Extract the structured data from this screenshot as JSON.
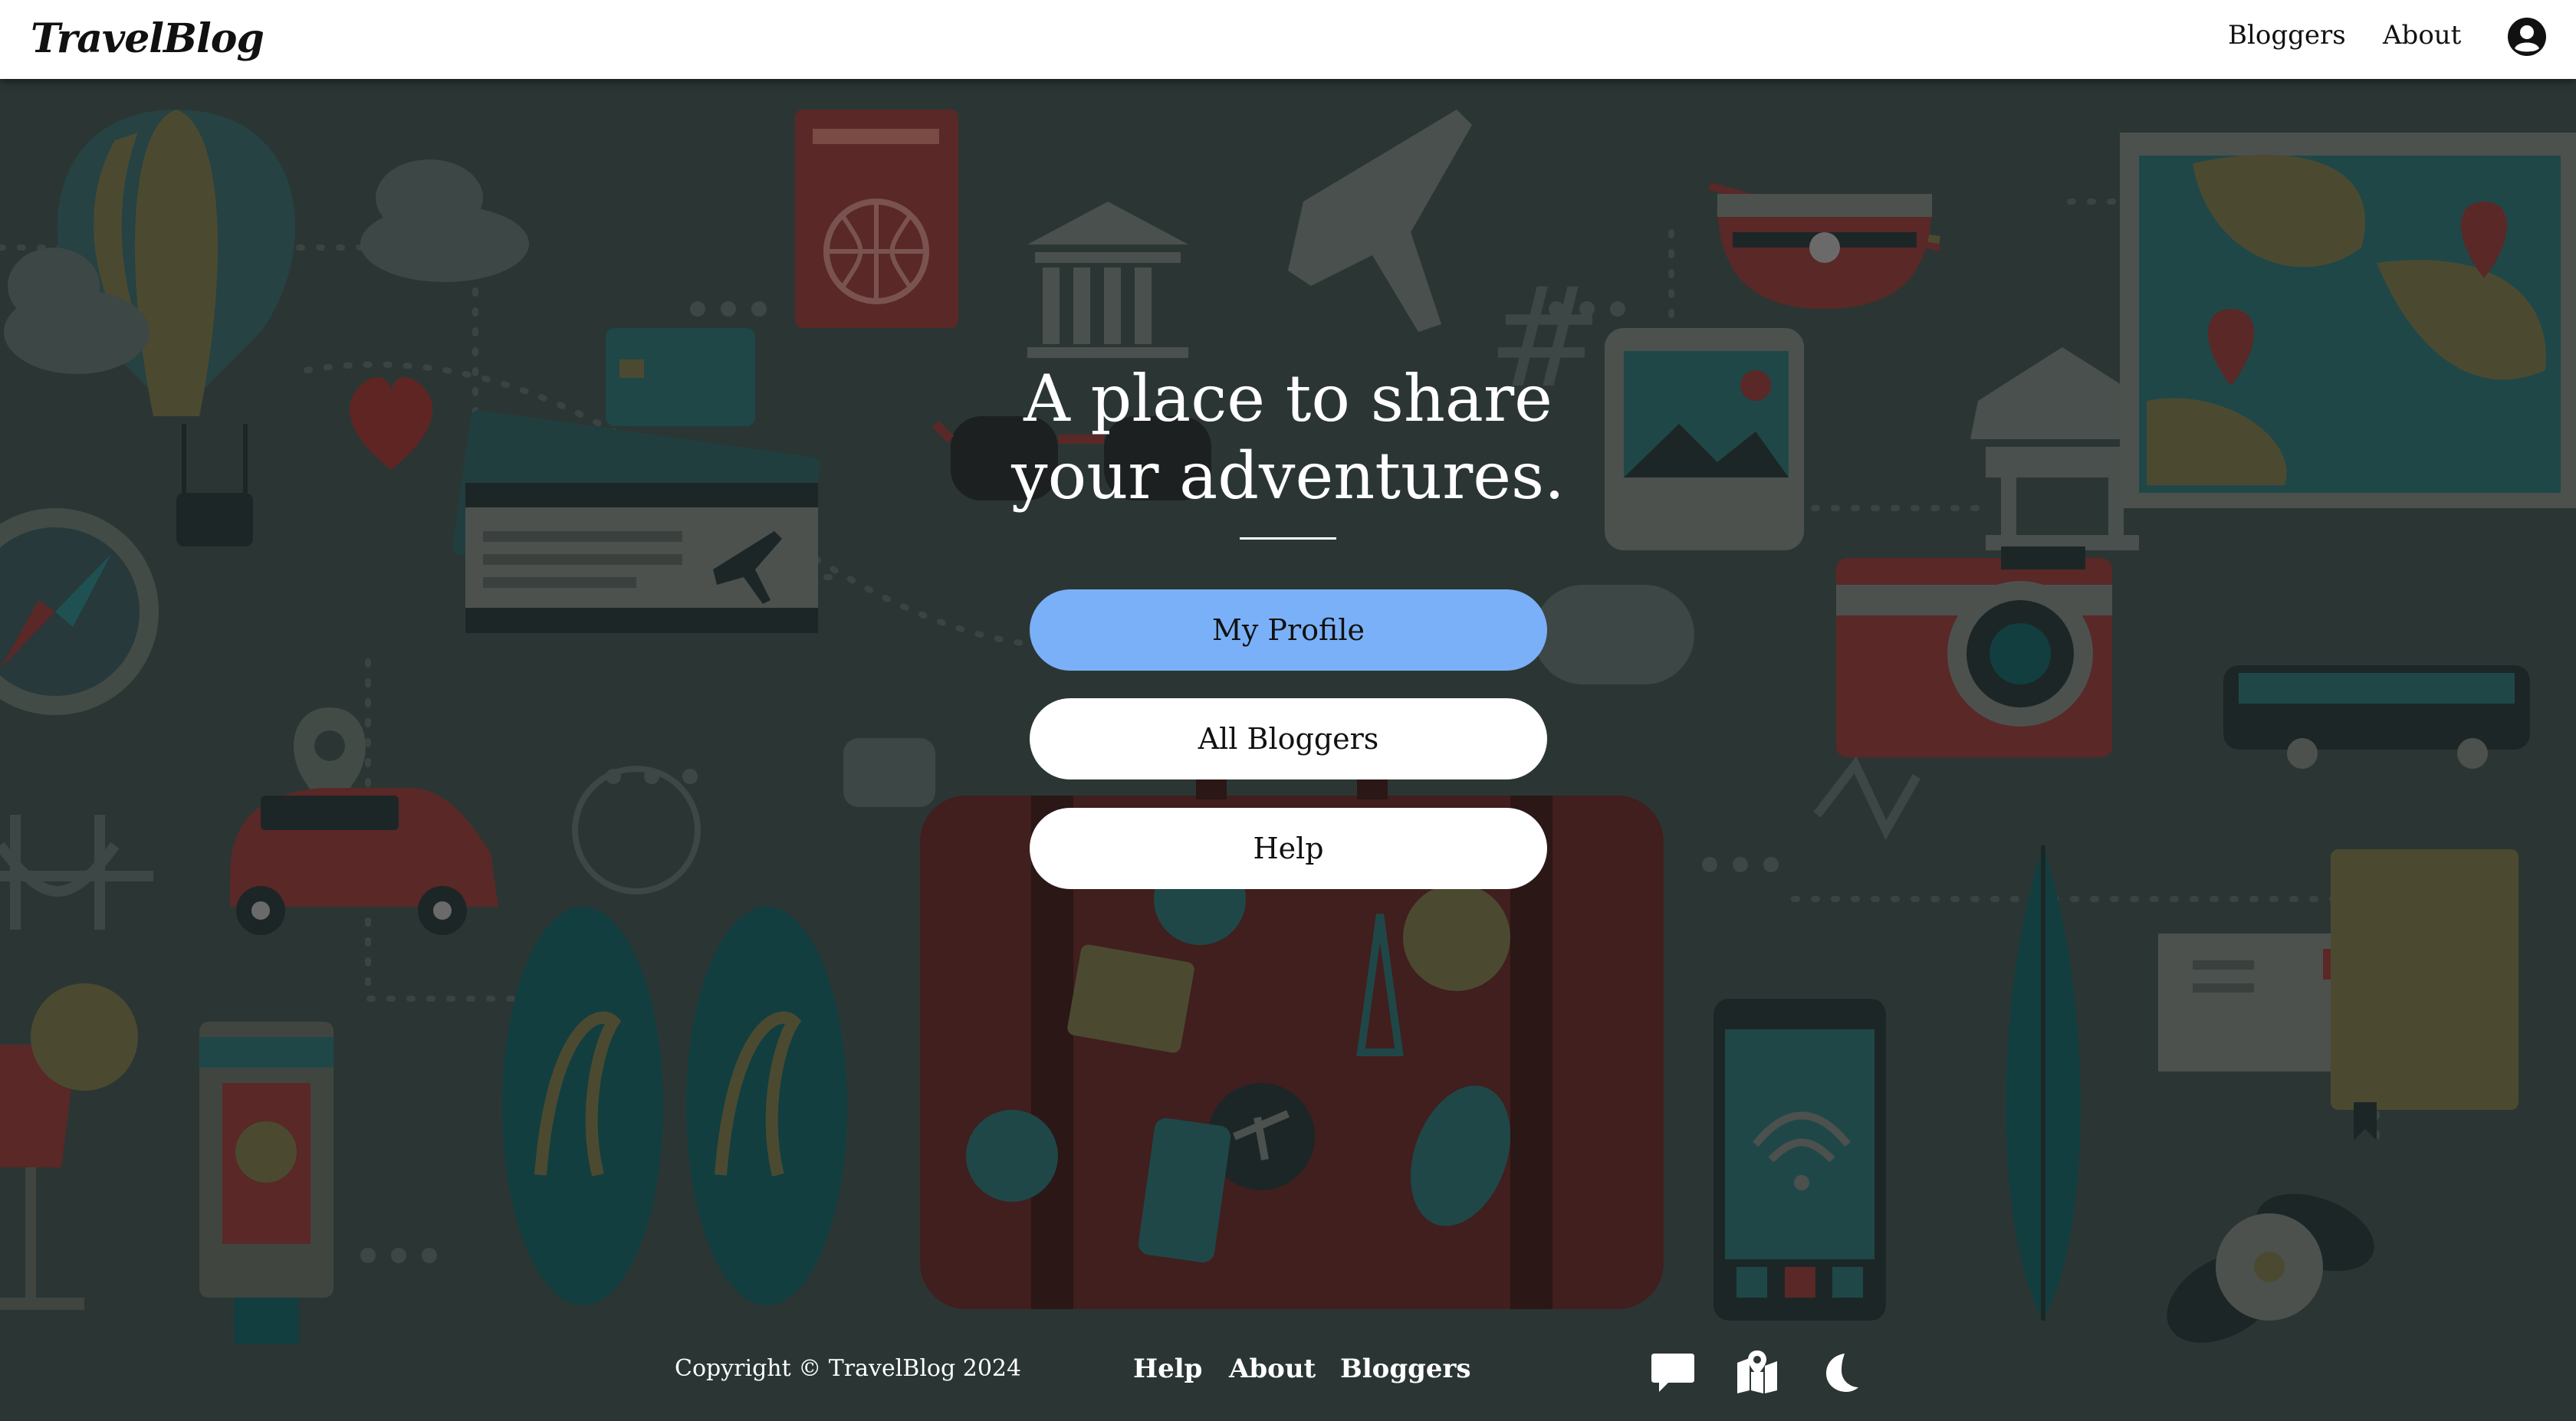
{
  "navbar": {
    "brand": "TravelBlog",
    "links": [
      "Bloggers",
      "About"
    ],
    "user_icon": "user-circle-icon"
  },
  "hero": {
    "headline_line1": "A place to share",
    "headline_line2": "your adventures.",
    "buttons": {
      "my_profile": "My Profile",
      "all_bloggers": "All Bloggers",
      "help": "Help"
    }
  },
  "footer": {
    "copyright": "Copyright © TravelBlog 2024",
    "links": [
      "Help",
      "About",
      "Bloggers"
    ],
    "icons": [
      "chat-icon",
      "map-icon",
      "moon-icon"
    ]
  },
  "colors": {
    "navbar_bg": "#ffffff",
    "overlay_bg": "#2b3634",
    "primary_button": "#7ab0f7",
    "secondary_button": "#ffffff",
    "text_light": "#ffffff"
  }
}
